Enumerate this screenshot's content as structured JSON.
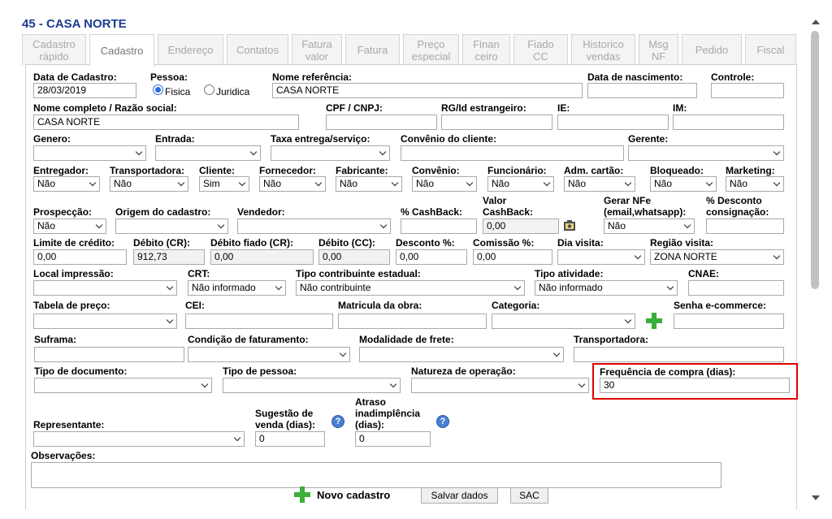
{
  "header": {
    "title": "45 - CASA NORTE"
  },
  "tabs": [
    {
      "label": "Cadastro\nrápido"
    },
    {
      "label": "Cadastro"
    },
    {
      "label": "Endereço"
    },
    {
      "label": "Contatos"
    },
    {
      "label": "Fatura\nvalor"
    },
    {
      "label": "Fatura"
    },
    {
      "label": "Preço\nespecial"
    },
    {
      "label": "Finan\nceiro"
    },
    {
      "label": "Fiado\nCC"
    },
    {
      "label": "Historico\nvendas"
    },
    {
      "label": "Msg\nNF"
    },
    {
      "label": "Pedido"
    },
    {
      "label": "Fiscal"
    }
  ],
  "form": {
    "data_cadastro": {
      "label": "Data de Cadastro:",
      "value": "28/03/2019"
    },
    "pessoa": {
      "label": "Pessoa:",
      "opt1": "Fisica",
      "opt2": "Juridica",
      "selected": "Fisica"
    },
    "nome_referencia": {
      "label": "Nome referência:",
      "value": "CASA NORTE"
    },
    "data_nascimento": {
      "label": "Data de nascimento:",
      "value": ""
    },
    "controle": {
      "label": "Controle:",
      "value": ""
    },
    "nome_completo": {
      "label": "Nome completo / Razão social:",
      "value": "CASA NORTE"
    },
    "cpf_cnpj": {
      "label": "CPF / CNPJ:",
      "value": ""
    },
    "rg": {
      "label": "RG/Id estrangeiro:",
      "value": ""
    },
    "ie": {
      "label": "IE:",
      "value": ""
    },
    "im": {
      "label": "IM:",
      "value": ""
    },
    "genero": {
      "label": "Genero:",
      "value": ""
    },
    "entrada": {
      "label": "Entrada:",
      "value": ""
    },
    "taxa_entrega": {
      "label": "Taxa entrega/serviço:",
      "value": ""
    },
    "convenio_cliente": {
      "label": "Convênio do cliente:",
      "value": ""
    },
    "gerente": {
      "label": "Gerente:",
      "value": ""
    },
    "entregador": {
      "label": "Entregador:",
      "value": "Não"
    },
    "transportadora_flag": {
      "label": "Transportadora:",
      "value": "Não"
    },
    "cliente": {
      "label": "Cliente:",
      "value": "Sim"
    },
    "fornecedor": {
      "label": "Fornecedor:",
      "value": "Não"
    },
    "fabricante": {
      "label": "Fabricante:",
      "value": "Não"
    },
    "convenio": {
      "label": "Convênio:",
      "value": "Não"
    },
    "funcionario": {
      "label": "Funcionário:",
      "value": "Não"
    },
    "adm_cartao": {
      "label": "Adm. cartão:",
      "value": "Não"
    },
    "bloqueado": {
      "label": "Bloqueado:",
      "value": "Não"
    },
    "marketing": {
      "label": "Marketing:",
      "value": "Não"
    },
    "prospeccao": {
      "label": "Prospecção:",
      "value": "Não"
    },
    "origem_cadastro": {
      "label": "Origem do cadastro:",
      "value": ""
    },
    "vendedor": {
      "label": "Vendedor:",
      "value": ""
    },
    "cashback_pct": {
      "label": "% CashBack:",
      "value": ""
    },
    "valor_cashback": {
      "label1": "Valor",
      "label2": "CashBack:",
      "value": "0,00"
    },
    "gerar_nfe": {
      "label1": "Gerar NFe",
      "label2": "(email,whatsapp):",
      "value": "Não"
    },
    "desconto_consignacao": {
      "label1": "% Desconto",
      "label2": "consignação:",
      "value": ""
    },
    "limite_credito": {
      "label": "Limite de crédito:",
      "value": "0,00"
    },
    "debito_cr": {
      "label": "Débito (CR):",
      "value": "912,73"
    },
    "debito_fiado": {
      "label": "Débito fiado (CR):",
      "value": "0,00"
    },
    "debito_cc": {
      "label": "Débito (CC):",
      "value": "0,00"
    },
    "desconto_pct": {
      "label": "Desconto %:",
      "value": "0,00"
    },
    "comissao_pct": {
      "label": "Comissão %:",
      "value": "0,00"
    },
    "dia_visita": {
      "label": "Dia visita:",
      "value": ""
    },
    "regiao_visita": {
      "label": "Região visita:",
      "value": "ZONA NORTE"
    },
    "local_impressao": {
      "label": "Local impressão:",
      "value": ""
    },
    "crt": {
      "label": "CRT:",
      "value": "Não informado"
    },
    "tipo_contribuinte": {
      "label": "Tipo contribuinte estadual:",
      "value": "Não contribuinte"
    },
    "tipo_atividade": {
      "label": "Tipo atividade:",
      "value": "Não informado"
    },
    "cnae": {
      "label": "CNAE:",
      "value": ""
    },
    "tabela_preco": {
      "label": "Tabela de preço:",
      "value": ""
    },
    "cei": {
      "label": "CEI:",
      "value": ""
    },
    "matricula_obra": {
      "label": "Matricula da obra:",
      "value": ""
    },
    "categoria": {
      "label": "Categoria:",
      "value": ""
    },
    "senha_ecommerce": {
      "label": "Senha e-commerce:",
      "value": ""
    },
    "suframa": {
      "label": "Suframa:",
      "value": ""
    },
    "condicao_faturamento": {
      "label": "Condição de faturamento:",
      "value": ""
    },
    "modalidade_frete": {
      "label": "Modalidade de frete:",
      "value": ""
    },
    "transportadora": {
      "label": "Transportadora:",
      "value": ""
    },
    "tipo_documento": {
      "label": "Tipo de documento:",
      "value": ""
    },
    "tipo_pessoa": {
      "label": "Tipo de pessoa:",
      "value": ""
    },
    "natureza_operacao": {
      "label": "Natureza de operação:",
      "value": ""
    },
    "frequencia_compra": {
      "label": "Frequência de compra (dias):",
      "value": "30"
    },
    "representante": {
      "label": "Representante:",
      "value": ""
    },
    "sugestao_venda": {
      "label1": "Sugestão de",
      "label2": "venda (dias):",
      "value": "0"
    },
    "atraso_inadimplencia": {
      "label1": "Atraso",
      "label2": "inadimplência",
      "label3": "(dias):",
      "value": "0"
    },
    "observacoes": {
      "label": "Observações:"
    }
  },
  "actions": {
    "novo_cadastro": "Novo cadastro",
    "salvar": "Salvar dados",
    "sac": "SAC"
  },
  "colors": {
    "title": "#1a3c8f",
    "highlight": "#e00000",
    "plus": "#3cae3c"
  }
}
